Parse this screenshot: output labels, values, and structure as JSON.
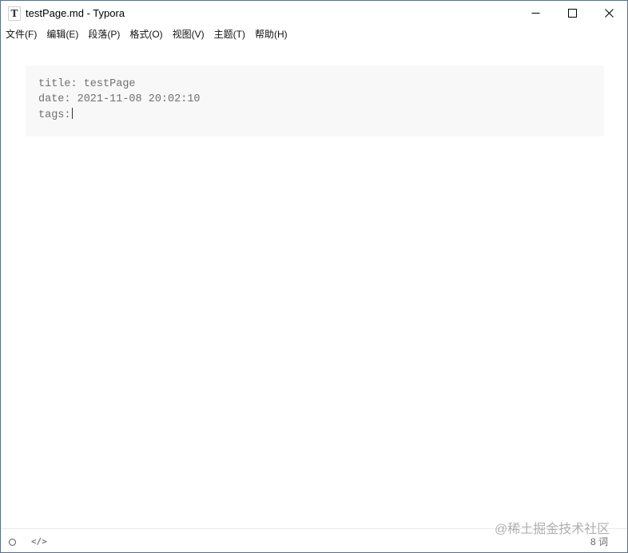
{
  "window": {
    "title": "testPage.md - Typora",
    "app_icon_letter": "T"
  },
  "menu": {
    "items": [
      {
        "label": "文件(F)"
      },
      {
        "label": "编辑(E)"
      },
      {
        "label": "段落(P)"
      },
      {
        "label": "格式(O)"
      },
      {
        "label": "视图(V)"
      },
      {
        "label": "主题(T)"
      },
      {
        "label": "帮助(H)"
      }
    ]
  },
  "editor": {
    "front_matter": {
      "lines": [
        "title: testPage",
        "date: 2021-11-08 20:02:10",
        "tags:"
      ]
    }
  },
  "statusbar": {
    "code_toggle": "</>",
    "word_count": "8 词"
  },
  "watermark": "@稀土掘金技术社区",
  "colors": {
    "front_matter_bg": "#f8f8f8",
    "front_matter_text": "#707070",
    "window_border": "#5b6f8c"
  }
}
